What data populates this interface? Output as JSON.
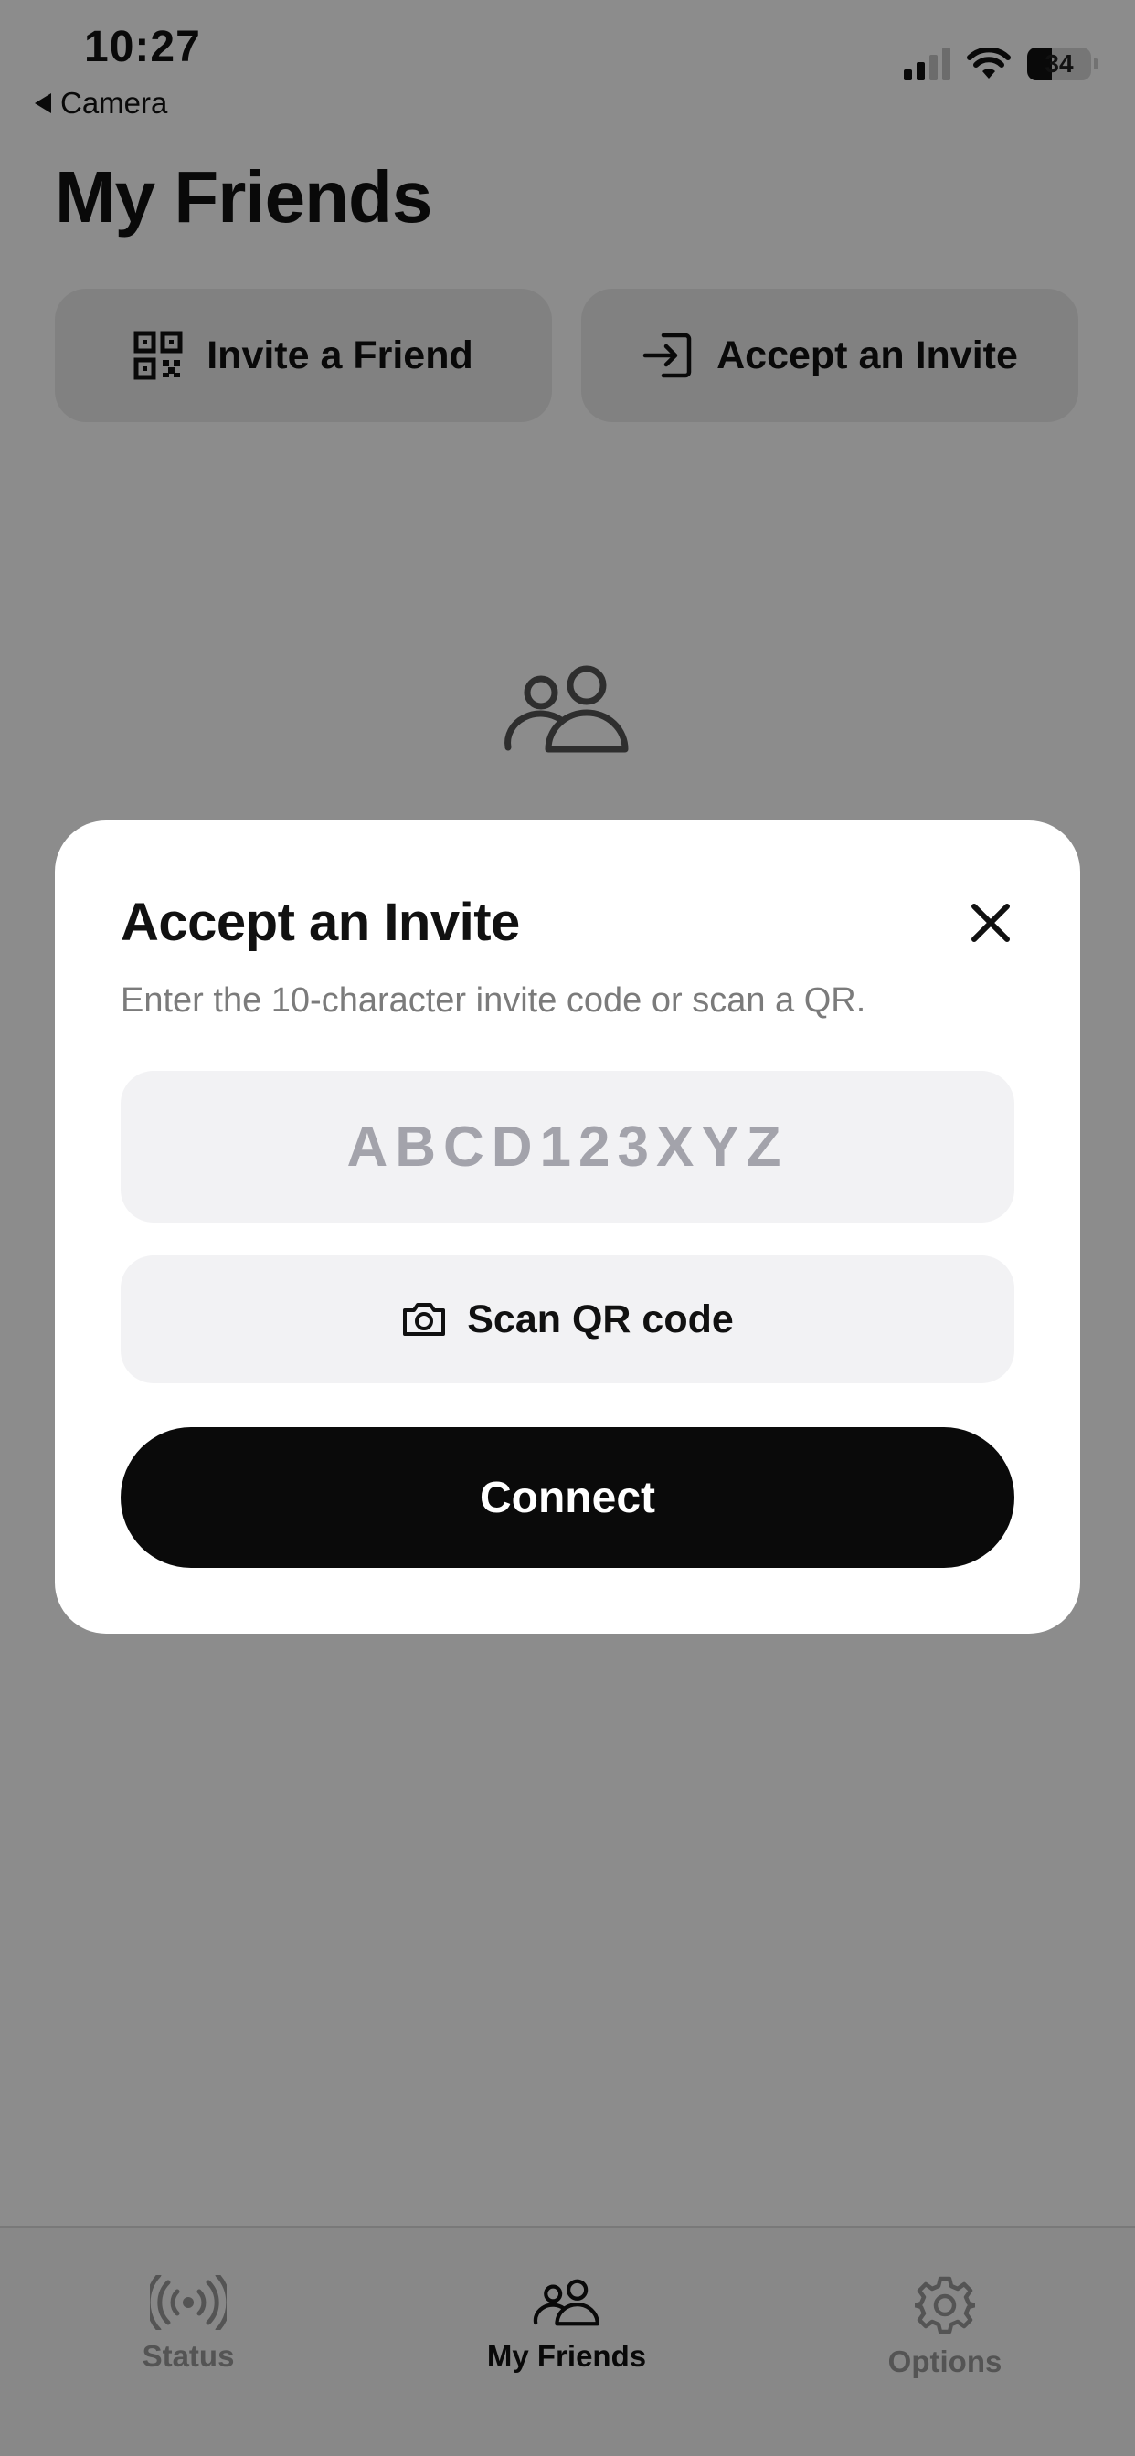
{
  "status_bar": {
    "time": "10:27",
    "back_app": "Camera",
    "battery": "34"
  },
  "header": {
    "title": "My Friends",
    "invite_label": "Invite a Friend",
    "accept_label": "Accept an Invite"
  },
  "modal": {
    "title": "Accept an Invite",
    "subtitle": "Enter the 10-character invite code or scan a QR.",
    "input_placeholder": "ABCD123XYZ",
    "input_value": "",
    "scan_label": "Scan QR code",
    "connect_label": "Connect"
  },
  "tabbar": {
    "items": [
      {
        "label": "Status",
        "icon": "broadcast-icon",
        "active": false
      },
      {
        "label": "My Friends",
        "icon": "friends-icon",
        "active": true
      },
      {
        "label": "Options",
        "icon": "gear-icon",
        "active": false
      }
    ]
  },
  "colors": {
    "accent": "#0a0a0a",
    "overlay": "#000000",
    "muted_text": "#7b7b7b"
  }
}
